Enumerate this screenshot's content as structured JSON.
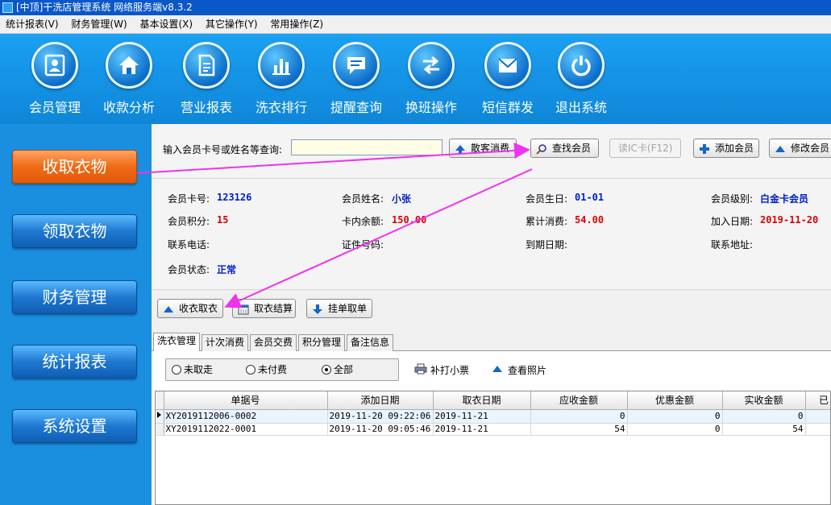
{
  "window": {
    "title": "[中顶]干洗店管理系统 网络服务端v8.3.2"
  },
  "menu": [
    "统计报表(V)",
    "财务管理(W)",
    "基本设置(X)",
    "其它操作(Y)",
    "常用操作(Z)"
  ],
  "toolbar": [
    {
      "label": "会员管理",
      "icon": "member-card-icon"
    },
    {
      "label": "收款分析",
      "icon": "home-icon"
    },
    {
      "label": "营业报表",
      "icon": "document-icon"
    },
    {
      "label": "洗衣排行",
      "icon": "bar-chart-icon"
    },
    {
      "label": "提醒查询",
      "icon": "chat-bubble-icon"
    },
    {
      "label": "换班操作",
      "icon": "swap-arrows-icon"
    },
    {
      "label": "短信群发",
      "icon": "envelope-icon"
    },
    {
      "label": "退出系统",
      "icon": "power-icon"
    }
  ],
  "nav": [
    "收取衣物",
    "领取衣物",
    "财务管理",
    "统计报表",
    "系统设置"
  ],
  "search": {
    "label": "输入会员卡号或姓名等查询:",
    "value": "",
    "scatter_btn": "散客消费",
    "find_btn": "查找会员",
    "ic_btn": "读IC卡(F12)",
    "add_btn": "添加会员",
    "edit_btn": "修改会员"
  },
  "member": {
    "card_no_label": "会员卡号:",
    "card_no": "123126",
    "name_label": "会员姓名:",
    "name": "小张",
    "birthday_label": "会员生日:",
    "birthday": "01-01",
    "level_label": "会员级别:",
    "level": "白金卡会员",
    "points_label": "会员积分:",
    "points": "15",
    "balance_label": "卡内余额:",
    "balance": "150.00",
    "total_label": "累计消费:",
    "total": "54.00",
    "join_label": "加入日期:",
    "join": "2019-11-20",
    "phone_label": "联系电话:",
    "id_label": "证件号码:",
    "expire_label": "到期日期:",
    "address_label": "联系地址:",
    "status_label": "会员状态:",
    "status": "正常"
  },
  "actions": {
    "collect": "收衣取衣",
    "settle": "取衣结算",
    "hang": "挂单取单"
  },
  "tabs": [
    "洗衣管理",
    "计次消费",
    "会员交费",
    "积分管理",
    "备注信息"
  ],
  "filters": {
    "options": [
      "未取走",
      "未付费",
      "全部"
    ],
    "selected": "全部"
  },
  "tools": {
    "reprint": "补打小票",
    "photo": "查看照片"
  },
  "table": {
    "headers": [
      "单据号",
      "添加日期",
      "取衣日期",
      "应收金额",
      "优惠金额",
      "实收金额",
      "已"
    ],
    "rows": [
      [
        "XY2019112006-0002",
        "2019-11-20 09:22:06",
        "2019-11-21",
        "0",
        "0",
        "0",
        ""
      ],
      [
        "XY2019112022-0001",
        "2019-11-20 09:05:46",
        "2019-11-21",
        "54",
        "0",
        "54",
        ""
      ]
    ]
  },
  "colors": {
    "accent": "#1a8fe0",
    "active_nav": "#f06a15",
    "annotation": "#ee33ee"
  }
}
